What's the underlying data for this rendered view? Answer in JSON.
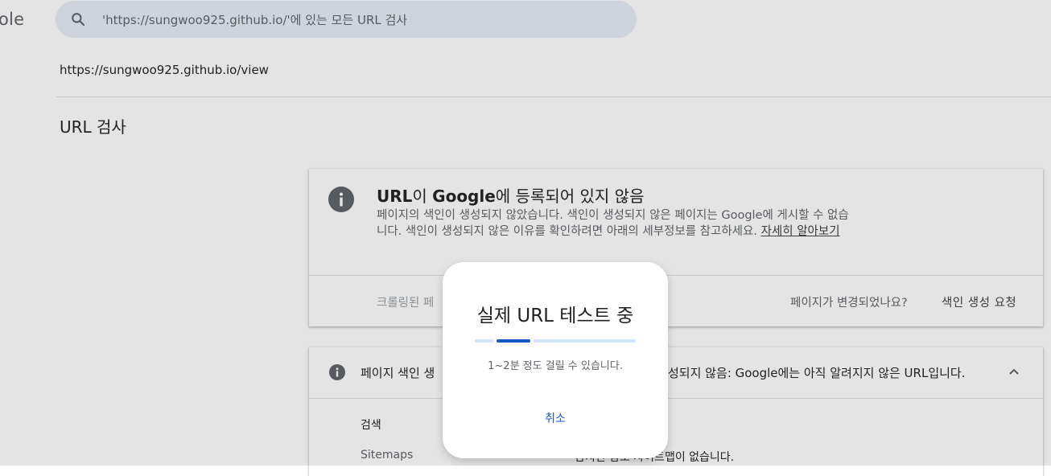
{
  "header": {
    "brand_fragment": "ole",
    "search_placeholder": "'https://sungwoo925.github.io/'에 있는 모든 URL 검사"
  },
  "inspected_url": "https://sungwoo925.github.io/view",
  "section_title": "URL 검사",
  "index_card": {
    "title_part1": "URL",
    "title_part2": "이 ",
    "title_part3": "Google",
    "title_part4": "에 등록되어 있지 않음",
    "description": "페이지의 색인이 생성되지 않았습니다. 색인이 생성되지 않은 페이지는 Google에 게시할 수 없습니다. 색인이 생성되지 않은 이유를 확인하려면 아래의 세부정보를 참고하세요. ",
    "learn_more": "자세히 알아보기",
    "crawled_label": "크롤링된 페",
    "page_changed": "페이지가 변경되었나요?",
    "request_indexing": "색인 생성 요청"
  },
  "status_card": {
    "status_pre": "페이지 색인 생",
    "status_post": "성되지 않음: Google에는 아직 알려지지 않은 URL입니다.",
    "rows": [
      {
        "label": "검색",
        "value": ""
      },
      {
        "label": "Sitemaps",
        "value": "감지된 참조 사이트맵이 없습니다."
      }
    ]
  },
  "dialog": {
    "title": "실제 URL 테스트 중",
    "subtitle": "1~2분 정도 걸릴 수 있습니다.",
    "cancel": "취소"
  },
  "colors": {
    "accent": "#1a56c6",
    "progress_track": "#d2e3fc",
    "search_bg": "#e8ecf6",
    "info_icon": "#5f6368"
  },
  "icons": [
    "search-icon",
    "info-icon",
    "chevron-up-icon"
  ]
}
